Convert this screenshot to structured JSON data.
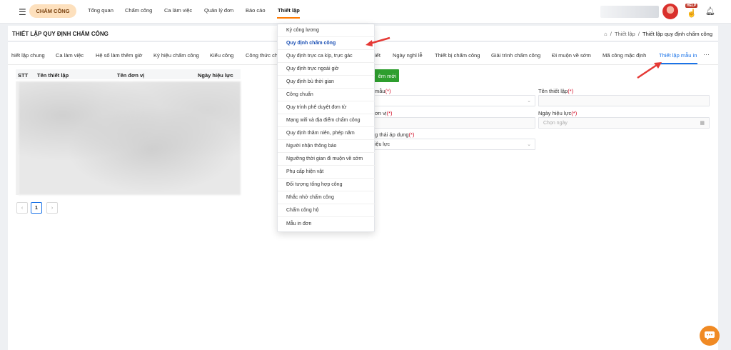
{
  "topbar": {
    "brand": "CHẤM CÔNG",
    "nav": [
      {
        "label": "Tổng quan"
      },
      {
        "label": "Chấm công"
      },
      {
        "label": "Ca làm việc"
      },
      {
        "label": "Quản lý đơn"
      },
      {
        "label": "Báo cáo"
      },
      {
        "label": "Thiết lập"
      }
    ],
    "help_label": "HELP"
  },
  "header": {
    "title": "THIẾT LẬP QUY ĐỊNH CHẤM CÔNG",
    "breadcrumb": [
      "Thiết lập",
      "Thiết lập quy định chấm công"
    ]
  },
  "tabs": [
    {
      "label": "hiết lập chung"
    },
    {
      "label": "Ca làm việc"
    },
    {
      "label": "Hệ số làm thêm giờ"
    },
    {
      "label": "Ký hiệu chấm công"
    },
    {
      "label": "Kiểu công"
    },
    {
      "label": "Công thức ch"
    },
    {
      "label": "iết"
    },
    {
      "label": "Ngày nghỉ lễ"
    },
    {
      "label": "Thiết bị chấm công"
    },
    {
      "label": "Giải trình chấm công"
    },
    {
      "label": "Đi muộn về sớm"
    },
    {
      "label": "Mã công mặc định"
    },
    {
      "label": "Thiết lập mẫu in"
    }
  ],
  "table": {
    "columns": [
      "STT",
      "Tên thiết lập",
      "Tên đơn vị",
      "Ngày hiệu lực"
    ],
    "page": "1"
  },
  "form": {
    "add_button": "êm mới",
    "fields": {
      "template_label": "mẫu",
      "setting_name_label": "Tên thiết lập",
      "unit_label": "ơn vị",
      "effective_date_label": "Ngày hiệu lực",
      "date_placeholder": "Chọn ngày",
      "status_label": "g thái áp dụng",
      "status_value": "iệu lực"
    },
    "required_mark": "(*)"
  },
  "dropdown": {
    "items": [
      {
        "label": "Kỳ công lương"
      },
      {
        "label": "Quy định chấm công"
      },
      {
        "label": "Quy định trực ca kíp, trực gác"
      },
      {
        "label": "Quy định trực ngoài giờ"
      },
      {
        "label": "Quy định bù thời gian"
      },
      {
        "label": "Công chuẩn"
      },
      {
        "label": "Quy trình phê duyệt đơn từ"
      },
      {
        "label": "Mạng wifi và địa điểm chấm công"
      },
      {
        "label": "Quy định thâm niên, phép năm"
      },
      {
        "label": "Người nhận thông báo"
      },
      {
        "label": "Ngưỡng thời gian đi muộn về sớm"
      },
      {
        "label": "Phụ cấp hiện vật"
      },
      {
        "label": "Đối tượng tổng hợp công"
      },
      {
        "label": "Nhắc nhở chấm công"
      },
      {
        "label": "Chấm công hộ"
      },
      {
        "label": "Mẫu in đơn"
      }
    ],
    "active_index": 1
  },
  "colors": {
    "accent_orange": "#ff7a00",
    "primary_blue": "#1a73e8",
    "add_green": "#2e9e2e",
    "arrow_red": "#e53935",
    "chat_orange": "#f08a24"
  }
}
